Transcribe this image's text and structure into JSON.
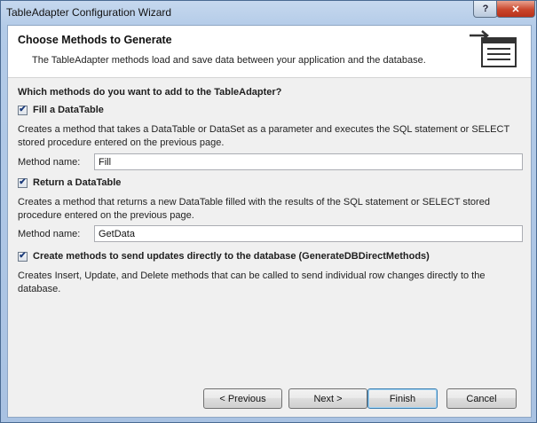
{
  "window": {
    "title": "TableAdapter Configuration Wizard",
    "help_label": "?",
    "close_label": "✕"
  },
  "header": {
    "title": "Choose Methods to Generate",
    "description": "The TableAdapter methods load and save data between your application and the database."
  },
  "content": {
    "question": "Which methods do you want to add to the TableAdapter?",
    "fill": {
      "checked": true,
      "label": "Fill a DataTable",
      "description": "Creates a method that takes a DataTable or DataSet as a parameter and executes the SQL statement or SELECT stored procedure entered on the previous page.",
      "method_label": "Method name:",
      "method_value": "Fill"
    },
    "get": {
      "checked": true,
      "label": "Return a DataTable",
      "description": "Creates a method that returns a new DataTable filled with the results of the SQL statement or SELECT stored procedure entered on the previous page.",
      "method_label": "Method name:",
      "method_value": "GetData"
    },
    "direct": {
      "checked": true,
      "label": "Create methods to send updates directly to the database (GenerateDBDirectMethods)",
      "description": "Creates Insert, Update, and Delete methods that can be called to send individual row changes directly to the database."
    }
  },
  "footer": {
    "previous": "< Previous",
    "next": "Next >",
    "finish": "Finish",
    "cancel": "Cancel"
  },
  "check_glyph": "✔",
  "colors": {
    "close_button": "#c9462c",
    "default_button_border": "#3c7fb1",
    "header_background": "#ffffff",
    "dialog_background": "#f0f0f0"
  }
}
